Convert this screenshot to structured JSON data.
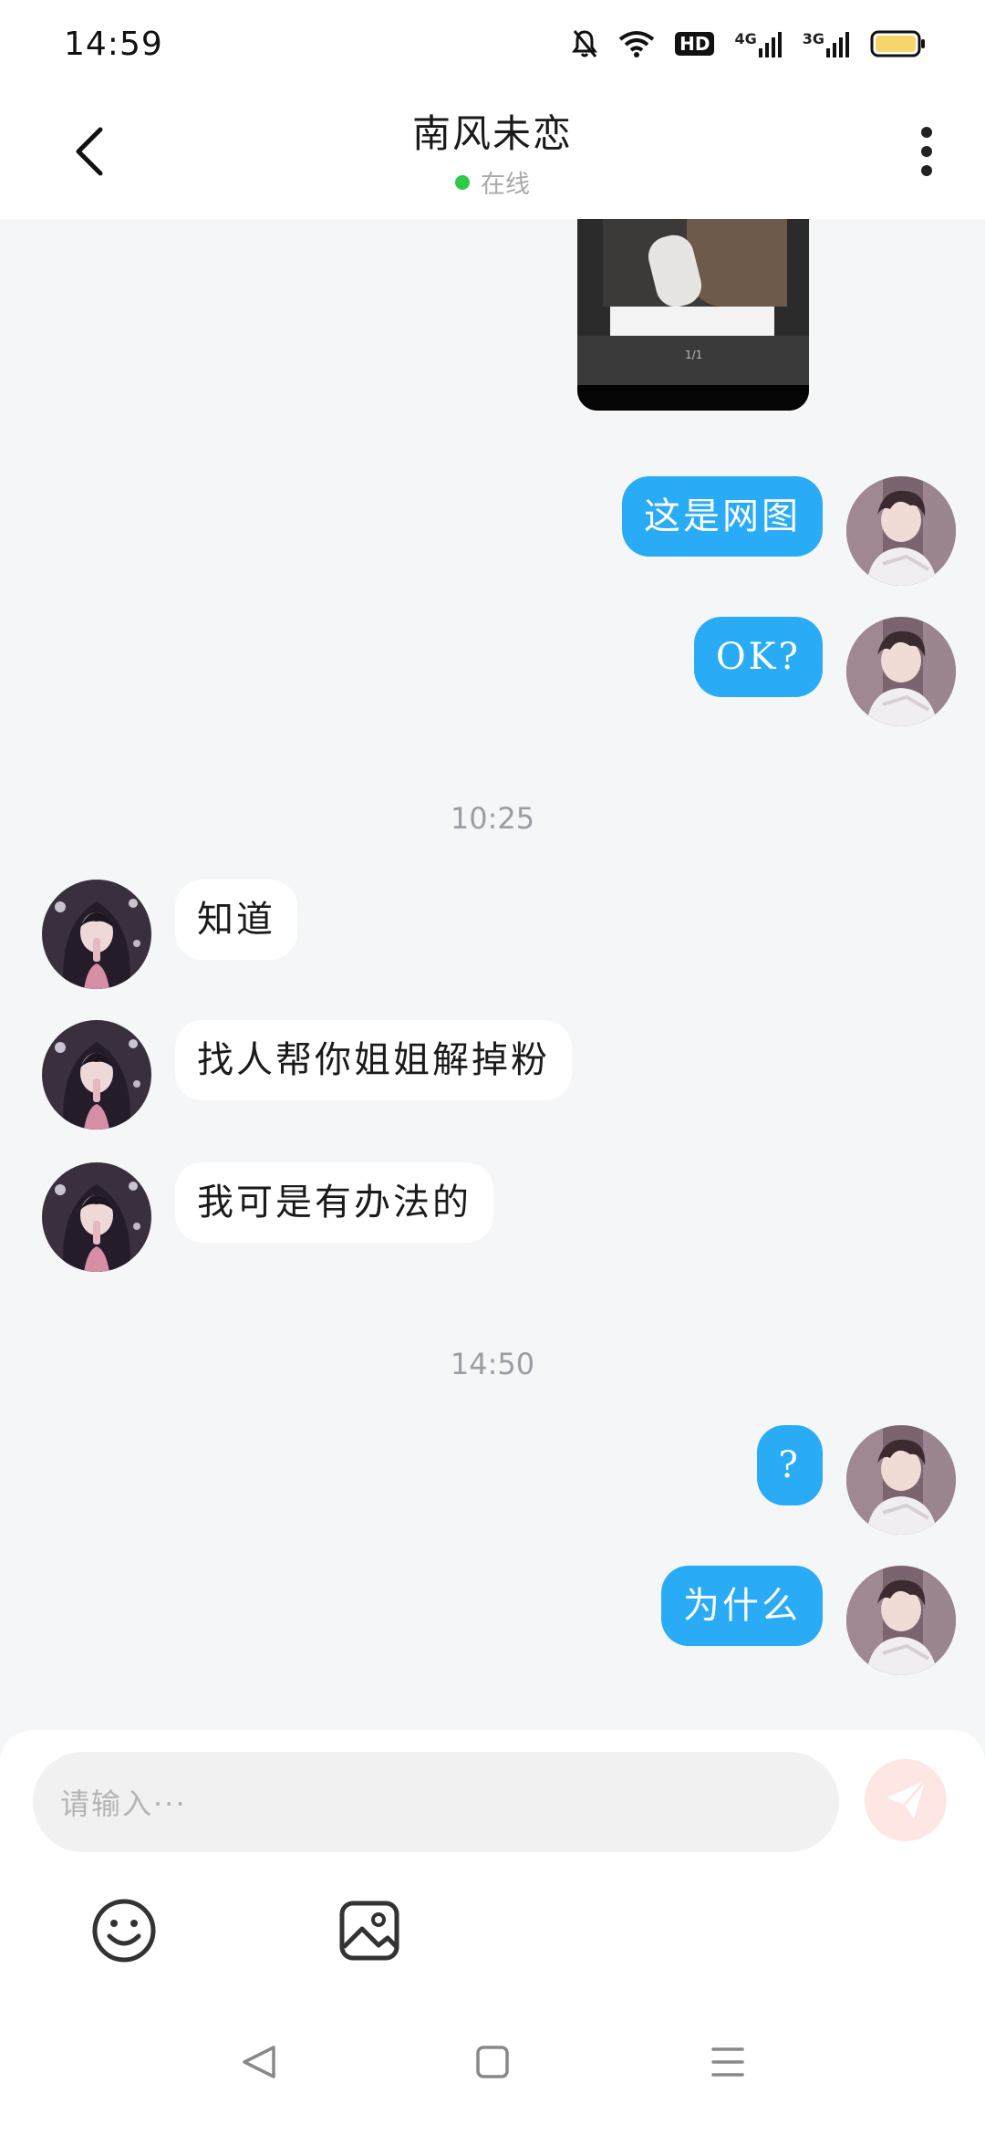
{
  "status_bar": {
    "time": "14:59",
    "icons": [
      "bell-off-icon",
      "wifi-icon",
      "hd-icon",
      "signal-4g-icon",
      "signal-3g-icon",
      "battery-icon"
    ],
    "hd_label": "HD",
    "net1_label": "4G",
    "net2_label": "3G"
  },
  "header": {
    "title": "南风未恋",
    "presence": "在线",
    "presence_color": "#2ec946"
  },
  "messages": [
    {
      "side": "out",
      "text": "这是网图"
    },
    {
      "side": "out",
      "text": "OK?"
    },
    {
      "side": "in",
      "text": "知道"
    },
    {
      "side": "in",
      "text": "找人帮你姐姐解掉粉"
    },
    {
      "side": "in",
      "text": "我可是有办法的"
    },
    {
      "side": "out",
      "text": "?"
    },
    {
      "side": "out",
      "text": "为什么"
    }
  ],
  "timestamps": [
    "10:25",
    "14:50"
  ],
  "shared_image": {
    "caption": "1/1"
  },
  "composer": {
    "placeholder": "请输入···"
  },
  "colors": {
    "outgoing_bubble": "#2aabf5",
    "incoming_bubble": "#ffffff",
    "background": "#f4f6f8",
    "send_button": "#fde6e3"
  }
}
